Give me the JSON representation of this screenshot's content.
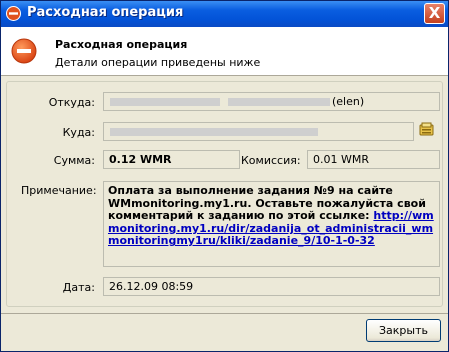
{
  "window": {
    "title": "Расходная операция",
    "close_label": "X"
  },
  "header": {
    "title": "Расходная операция",
    "subtitle": "Детали операции приведены ниже"
  },
  "form": {
    "from_label": "Откуда:",
    "from_value_suffix": "(elen)",
    "to_label": "Куда:",
    "amount_label": "Сумма:",
    "amount_value": "0.12 WMR",
    "fee_label": "Комиссия:",
    "fee_value": "0.01 WMR",
    "note_label": "Примечание:",
    "note_text": "Оплата за выполнение задания №9 на сайте WMmonitoring.my1.ru. Оставьте пожалуйста свой комментарий к заданию по этой ссылке:",
    "note_link": "http://wmmonitoring.my1.ru/dir/zadanija_ot_administracii_wmmonitoringmy1ru/kliki/zadanie_9/10-1-0-32",
    "date_label": "Дата:",
    "date_value": "26.12.09 08:59"
  },
  "buttons": {
    "close_label": "Закрыть"
  },
  "colors": {
    "title_bar": "#0a5ee0",
    "dialog_bg": "#ece9d8",
    "link": "#0000c0",
    "icon_red": "#e0521c"
  }
}
